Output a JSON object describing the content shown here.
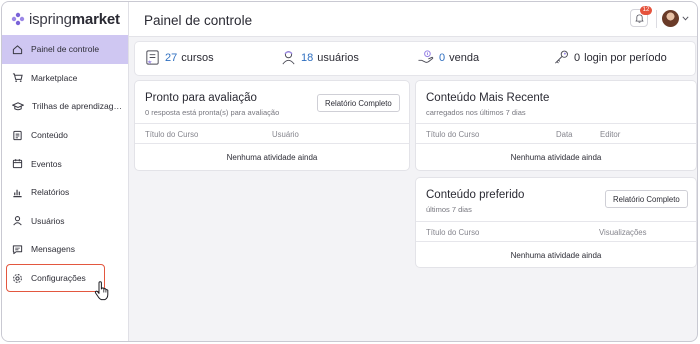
{
  "brand": {
    "name_light": "ispring",
    "name_bold": "market"
  },
  "header": {
    "title": "Painel de controle",
    "notification_count": "12"
  },
  "sidebar": {
    "items": [
      {
        "label": "Painel de controle",
        "icon": "home-icon",
        "active": true
      },
      {
        "label": "Marketplace",
        "icon": "cart-icon"
      },
      {
        "label": "Trilhas de aprendizagem",
        "icon": "graduation-cap-icon"
      },
      {
        "label": "Conteúdo",
        "icon": "content-icon"
      },
      {
        "label": "Eventos",
        "icon": "calendar-icon"
      },
      {
        "label": "Relatórios",
        "icon": "bar-chart-icon"
      },
      {
        "label": "Usuários",
        "icon": "user-icon"
      },
      {
        "label": "Mensagens",
        "icon": "message-icon"
      },
      {
        "label": "Configurações",
        "icon": "gear-icon"
      }
    ]
  },
  "stats": {
    "courses": {
      "value": "27",
      "label": "cursos"
    },
    "users": {
      "value": "18",
      "label": "usuários"
    },
    "sales": {
      "value": "0",
      "label": "venda"
    },
    "logins": {
      "value": "0",
      "label": "login por período"
    }
  },
  "cards": {
    "ready": {
      "title": "Pronto para avaliação",
      "subtitle": "0 resposta está pronta(s) para avaliação",
      "button": "Relatório Completo",
      "columns": [
        "Título do Curso",
        "Usuário"
      ],
      "empty": "Nenhuma atividade ainda"
    },
    "recent": {
      "title": "Conteúdo Mais Recente",
      "subtitle": "carregados nos últimos 7 dias",
      "columns": [
        "Título do Curso",
        "Data",
        "Editor"
      ],
      "empty": "Nenhuma atividade ainda"
    },
    "favorite": {
      "title": "Conteúdo preferido",
      "subtitle": "últimos 7 dias",
      "button": "Relatório Completo",
      "columns": [
        "Título do Curso",
        "Visualizações"
      ],
      "empty": "Nenhuma atividade ainda"
    }
  },
  "colors": {
    "accent": "#cfc7f2",
    "link": "#2f6fc0",
    "highlight": "#e3573f",
    "badge": "#e5533d"
  }
}
